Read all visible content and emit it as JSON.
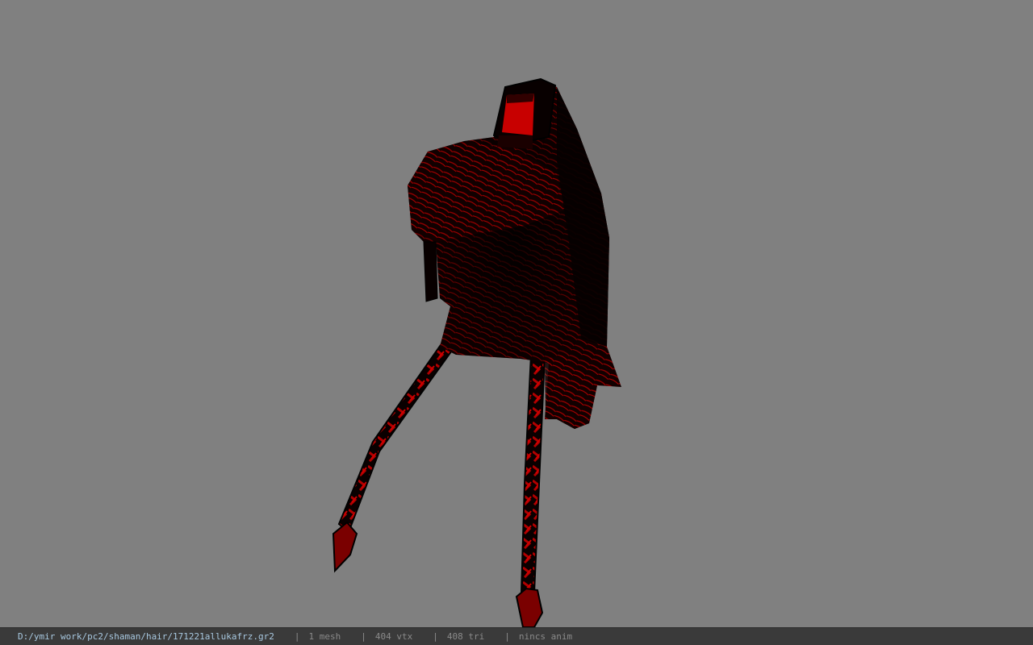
{
  "viewer": {
    "background_color": "#808080",
    "model_colors": {
      "dark": "#0b0000",
      "red": "#b30000",
      "bright_red": "#e01010"
    }
  },
  "status": {
    "file_path": "D:/ymir work/pc2/shaman/hair/171221allukafrz.gr2",
    "separator": "|",
    "mesh_count": "1 mesh",
    "vertex_count": "404 vtx",
    "triangle_count": "408 tri",
    "anim_status": "nincs anim"
  }
}
